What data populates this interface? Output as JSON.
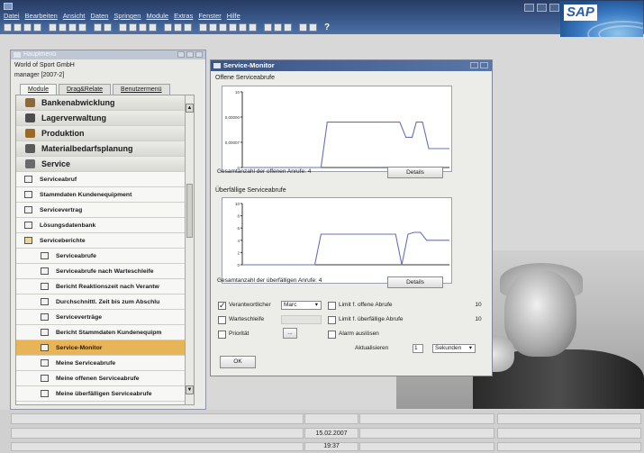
{
  "menubar": [
    "Datei",
    "Bearbeiten",
    "Ansicht",
    "Daten",
    "Springen",
    "Module",
    "Extras",
    "Fenster",
    "Hilfe"
  ],
  "brand": {
    "logo_text": "SAP"
  },
  "toolbar": {
    "help_glyph": "?"
  },
  "main_menu": {
    "title": "Hauptmenü",
    "company": "World of Sport GmbH",
    "user": "manager [2007-2]",
    "tabs": [
      "Module",
      "Drag&Relate",
      "Benutzermenü"
    ],
    "modules": [
      {
        "label": "Bankenabwicklung",
        "icon": "bank-icon",
        "color": "#8a6a3a"
      },
      {
        "label": "Lagerverwaltung",
        "icon": "warehouse-icon",
        "color": "#4d4d4d"
      },
      {
        "label": "Produktion",
        "icon": "production-icon",
        "color": "#9a6a2a"
      },
      {
        "label": "Materialbedarfsplanung",
        "icon": "mrp-icon",
        "color": "#5a5a5a"
      },
      {
        "label": "Service",
        "icon": "service-icon",
        "color": "#6a6a6a"
      }
    ],
    "service_items": [
      "Serviceabruf",
      "Stammdaten Kundenequipment",
      "Servicevertrag",
      "Lösungsdatenbank"
    ],
    "reports_folder": "Serviceberichte",
    "reports": [
      "Serviceabrufe",
      "Serviceabrufe nach Warteschleife",
      "Bericht Reaktionszeit nach Verantw",
      "Durchschnittl. Zeit bis zum Abschlu",
      "Serviceverträge",
      "Bericht Stammdaten Kundenequipm",
      "Service-Monitor",
      "Meine Serviceabrufe",
      "Meine offenen Serviceabrufe",
      "Meine überfälligen Serviceabrufe"
    ],
    "selected_report": "Service-Monitor"
  },
  "monitor": {
    "title": "Service-Monitor",
    "open_section": "Offene Serviceabrufe",
    "open_summary": "Gesamtanzahl der offenen Anrufe: 4",
    "overdue_section": "Überfällige Serviceabrufe",
    "overdue_summary": "Gesamtanzahl der überfälligen Anrufe: 4",
    "details_label": "Details",
    "responsible_label": "Verantwortlicher",
    "responsible_value": "Marc",
    "responsible_checked": true,
    "queue_label": "Warteschleife",
    "priority_label": "Priorität",
    "ellipsis": "...",
    "limit_open_label": "Limit f. offene Abrufe",
    "limit_open_value": "10",
    "limit_overdue_label": "Limit f. überfällige Abrufe",
    "limit_overdue_value": "10",
    "alarm_label": "Alarm auslösen",
    "refresh_label": "Aktualisieren",
    "refresh_value": "1",
    "refresh_unit": "Sekunden",
    "ok_label": "OK"
  },
  "statusbar": {
    "date": "15.02.2007",
    "time": "19:37"
  },
  "chart_data": [
    {
      "type": "line",
      "title": "Offene Serviceabrufe",
      "yticks": [
        "10",
        "0,00000",
        "0,00007",
        "0"
      ],
      "series": [
        {
          "x": [
            0,
            0.38,
            0.41,
            0.76,
            0.79,
            0.82,
            0.84,
            0.87,
            0.9,
            0.93,
            1
          ],
          "y": [
            0,
            0,
            0.6,
            0.6,
            0.4,
            0.4,
            0.6,
            0.6,
            0.25,
            0.25,
            0.25
          ]
        }
      ]
    },
    {
      "type": "line",
      "title": "Überfällige Serviceabrufe",
      "yticks": [
        "10",
        "8",
        "6",
        "4",
        "2",
        "0"
      ],
      "ylim": [
        0,
        10
      ],
      "series": [
        {
          "x": [
            0,
            0.35,
            0.38,
            0.74,
            0.77,
            0.8,
            0.83,
            0.86,
            0.89,
            1
          ],
          "y": [
            0,
            0,
            5,
            5,
            0,
            5,
            5.3,
            5.3,
            4,
            4
          ]
        }
      ]
    }
  ]
}
